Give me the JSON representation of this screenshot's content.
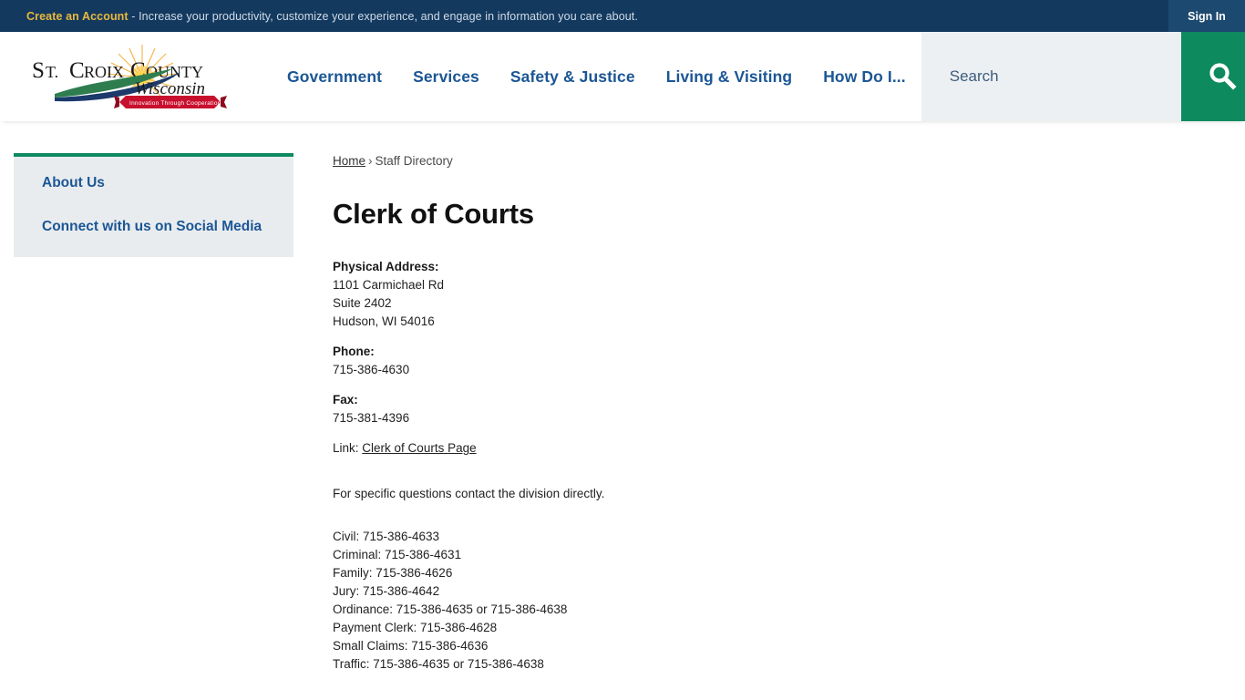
{
  "topbar": {
    "account_link": "Create an Account",
    "message": " - Increase your productivity, customize your experience, and engage in information you care about.",
    "sign_in": "Sign In"
  },
  "logo": {
    "line1": "ST. CROIX COUNTY",
    "script": "Wisconsin",
    "ribbon": "Innovation Through Cooperation",
    "alt": "St. Croix County Wisconsin - Innovation Through Cooperation"
  },
  "nav": {
    "items": [
      {
        "label": "Government"
      },
      {
        "label": "Services"
      },
      {
        "label": "Safety & Justice"
      },
      {
        "label": "Living & Visiting"
      },
      {
        "label": "How Do I..."
      }
    ]
  },
  "search": {
    "placeholder": "Search",
    "value": "",
    "icon": "search-icon"
  },
  "sidebar": {
    "items": [
      {
        "label": "About Us"
      },
      {
        "label": "Connect with us on Social Media"
      }
    ]
  },
  "breadcrumb": {
    "home": "Home",
    "separator": "›",
    "current": "Staff Directory"
  },
  "main": {
    "title": "Clerk of Courts",
    "address": {
      "label": "Physical Address:",
      "line1": "1101 Carmichael Rd",
      "line2": "Suite 2402",
      "line3": "Hudson, WI 54016"
    },
    "phone": {
      "label": "Phone:",
      "value": "715-386-4630"
    },
    "fax": {
      "label": "Fax:",
      "value": "715-381-4396"
    },
    "link": {
      "prefix": "Link:",
      "text": "Clerk of Courts Page"
    },
    "note": "For specific questions contact the division directly.",
    "divisions": [
      {
        "line": "Civil: 715-386-4633"
      },
      {
        "line": "Criminal: 715-386-4631"
      },
      {
        "line": "Family: 715-386-4626"
      },
      {
        "line": "Jury: 715-386-4642"
      },
      {
        "line": "Ordinance: 715-386-4635 or 715-386-4638"
      },
      {
        "line": "Payment Clerk: 715-386-4628"
      },
      {
        "line": "Small Claims: 715-386-4636"
      },
      {
        "line": "Traffic: 715-386-4635 or 715-386-4638"
      }
    ]
  },
  "colors": {
    "topbar_blue": "#14395F",
    "nav_blue": "#1B5695",
    "accent_green": "#0E8A5F",
    "gold": "#E9B93C",
    "sidebar_gray": "#E9ECEF"
  }
}
